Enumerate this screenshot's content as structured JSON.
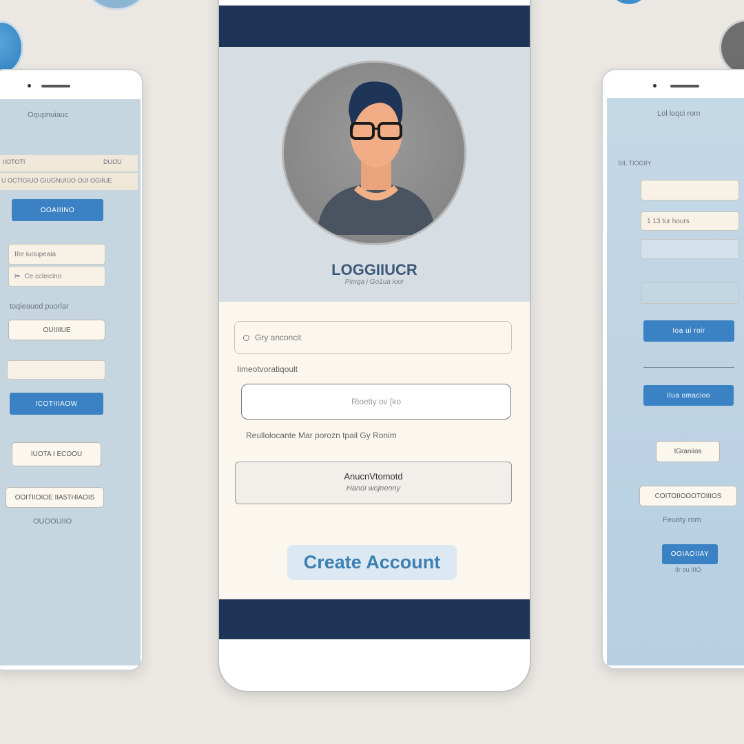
{
  "left_phone": {
    "title": "Oqupnuiauc",
    "row1_left": "IIOTOTI",
    "row1_right": "DUIJU",
    "row2": "U OCTIGIUO GIUGNUIUO OUI OGIIUE",
    "button1": "OOAIIINO",
    "input1": "IIIe iuoupeaia",
    "input2": "Ce ccleicinn",
    "input2_icon": "✂",
    "label": "toqieauod puorlar",
    "input_button": "OUIIIIUE",
    "button2": "ICOTIIIAOW",
    "outline1": "IUOTA I ECOOU",
    "outline2": "OOITIIOIOE IIA5THIAOIS",
    "footer": "OUOOUIIO"
  },
  "center_phone": {
    "title": "LOGGIIUCR",
    "subtitle": "Pimga i Go1ua ioor",
    "field1": "Gry anconcit",
    "label": "Iimeotvoratiqoult",
    "field2": "Rioetiy ov [ko",
    "note": "Reullolocante Mar porozn tpail Gy Ronim",
    "card_title": "AnucnVtomotd",
    "card_subtitle": "Hanoi wojnenny",
    "create_account": "Create Account"
  },
  "right_phone": {
    "title": "Lol loqci rom",
    "label": "SIL TIOGIIY",
    "input2": "1 13 tur hours",
    "button1": "Ioa ui roir",
    "button2": "Ilua omacioo",
    "outline1": "IGraniios",
    "outline2": "COITOIIOOOTOIIIOS",
    "text": "Feuoty rom",
    "button3": "OOIAOIIAY",
    "footer": "IIr ou IIIO"
  },
  "colors": {
    "navy": "#1e3557",
    "accent": "#3b82c4",
    "header": "#d6dee3",
    "cream": "#fbf7ef",
    "create_text": "#3c7fb3"
  }
}
